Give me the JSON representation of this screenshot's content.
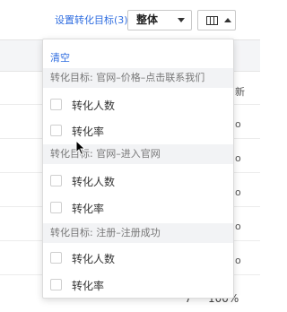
{
  "toolbar": {
    "settings_link": "设置转化目标(3)",
    "scope_value": "整体"
  },
  "table": {
    "header_fragment": "新",
    "row_edge_fragment": "o",
    "last_row": {
      "value": "7",
      "percent": "100%"
    }
  },
  "dropdown": {
    "clear_label": "清空",
    "groups": [
      {
        "title": "转化目标: 官网–价格–点击联系我们",
        "options": [
          "转化人数",
          "转化率"
        ]
      },
      {
        "title": "转化目标: 官网–进入官网",
        "options": [
          "转化人数",
          "转化率"
        ]
      },
      {
        "title": "转化目标: 注册–注册成功",
        "options": [
          "转化人数",
          "转化率"
        ]
      }
    ]
  },
  "colors": {
    "link": "#2f6de0",
    "group_bg": "#f2f3f5"
  }
}
